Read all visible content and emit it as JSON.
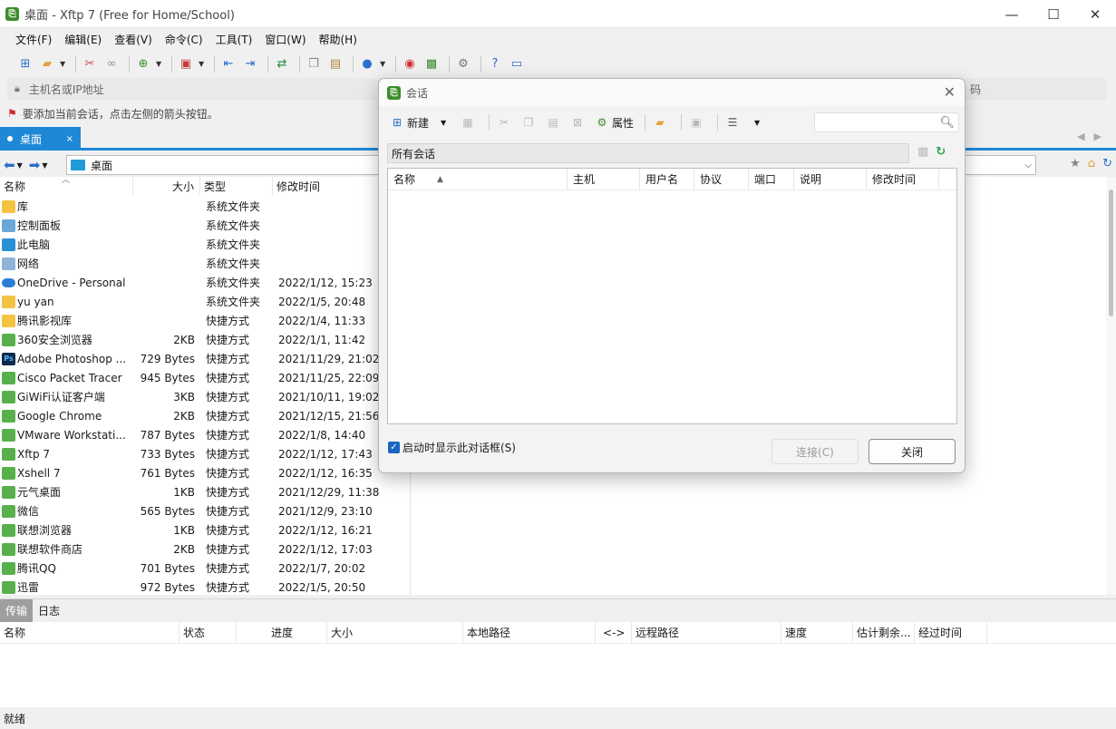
{
  "window": {
    "title": "桌面 - Xftp 7 (Free for Home/School)",
    "controls": [
      "—",
      "☐",
      "✕"
    ]
  },
  "menu": [
    "文件(F)",
    "编辑(E)",
    "查看(V)",
    "命令(C)",
    "工具(T)",
    "窗口(W)",
    "帮助(H)"
  ],
  "address": {
    "placeholder": "主机名或IP地址",
    "right_placeholder": "码"
  },
  "hint": "要添加当前会话，点击左侧的箭头按钮。",
  "tab": {
    "label": "桌面",
    "close": "×"
  },
  "path": {
    "current": "桌面"
  },
  "file_list": {
    "headers": [
      "名称",
      "大小",
      "类型",
      "修改时间"
    ],
    "rows": [
      {
        "icon": "folder-icon",
        "name": "库",
        "size": "",
        "type": "系统文件夹",
        "modified": ""
      },
      {
        "icon": "control-panel-icon",
        "name": "控制面板",
        "size": "",
        "type": "系统文件夹",
        "modified": ""
      },
      {
        "icon": "computer-icon",
        "name": "此电脑",
        "size": "",
        "type": "系统文件夹",
        "modified": ""
      },
      {
        "icon": "network-icon",
        "name": "网络",
        "size": "",
        "type": "系统文件夹",
        "modified": ""
      },
      {
        "icon": "cloud-icon",
        "name": "OneDrive - Personal",
        "size": "",
        "type": "系统文件夹",
        "modified": "2022/1/12, 15:23"
      },
      {
        "icon": "folder-icon",
        "name": "yu yan",
        "size": "",
        "type": "系统文件夹",
        "modified": "2022/1/5, 20:48"
      },
      {
        "icon": "folder-icon",
        "name": "腾讯影视库",
        "size": "",
        "type": "快捷方式",
        "modified": "2022/1/4, 11:33"
      },
      {
        "icon": "shortcut-icon",
        "name": "360安全浏览器",
        "size": "2KB",
        "type": "快捷方式",
        "modified": "2022/1/1, 11:42"
      },
      {
        "icon": "photoshop-icon",
        "name": "Adobe Photoshop ...",
        "size": "729 Bytes",
        "type": "快捷方式",
        "modified": "2021/11/29, 21:02"
      },
      {
        "icon": "shortcut-icon",
        "name": "Cisco Packet Tracer",
        "size": "945 Bytes",
        "type": "快捷方式",
        "modified": "2021/11/25, 22:09"
      },
      {
        "icon": "wifi-icon",
        "name": "GiWiFi认证客户端",
        "size": "3KB",
        "type": "快捷方式",
        "modified": "2021/10/11, 19:02"
      },
      {
        "icon": "chrome-icon",
        "name": "Google Chrome",
        "size": "2KB",
        "type": "快捷方式",
        "modified": "2021/12/15, 21:56"
      },
      {
        "icon": "vmware-icon",
        "name": "VMware Workstati...",
        "size": "787 Bytes",
        "type": "快捷方式",
        "modified": "2022/1/8, 14:40"
      },
      {
        "icon": "xftp-icon",
        "name": "Xftp 7",
        "size": "733 Bytes",
        "type": "快捷方式",
        "modified": "2022/1/12, 17:43"
      },
      {
        "icon": "xshell-icon",
        "name": "Xshell 7",
        "size": "761 Bytes",
        "type": "快捷方式",
        "modified": "2022/1/12, 16:35"
      },
      {
        "icon": "shortcut-icon",
        "name": "元气桌面",
        "size": "1KB",
        "type": "快捷方式",
        "modified": "2021/12/29, 11:38"
      },
      {
        "icon": "wechat-icon",
        "name": "微信",
        "size": "565 Bytes",
        "type": "快捷方式",
        "modified": "2021/12/9, 23:10"
      },
      {
        "icon": "shortcut-icon",
        "name": "联想浏览器",
        "size": "1KB",
        "type": "快捷方式",
        "modified": "2022/1/12, 16:21"
      },
      {
        "icon": "shortcut-icon",
        "name": "联想软件商店",
        "size": "2KB",
        "type": "快捷方式",
        "modified": "2022/1/12, 17:03"
      },
      {
        "icon": "qq-icon",
        "name": "腾讯QQ",
        "size": "701 Bytes",
        "type": "快捷方式",
        "modified": "2022/1/7, 20:02"
      },
      {
        "icon": "thunder-icon",
        "name": "迅雷",
        "size": "972 Bytes",
        "type": "快捷方式",
        "modified": "2022/1/5, 20:50"
      }
    ]
  },
  "bottom_tabs": [
    "传输",
    "日志"
  ],
  "transfer": {
    "headers": [
      "名称",
      "状态",
      "进度",
      "大小",
      "本地路径",
      "<->",
      "远程路径",
      "速度",
      "估计剩余...",
      "经过时间"
    ]
  },
  "status": "就绪",
  "dialog": {
    "title": "会话",
    "toolbar": {
      "new_label": "新建",
      "properties_label": "属性"
    },
    "path": "所有会话",
    "headers": [
      "名称",
      "主机",
      "用户名",
      "协议",
      "端口",
      "说明",
      "修改时间"
    ],
    "show_on_startup_label": "启动时显示此对话框(S)",
    "show_on_startup_checked": true,
    "connect_label": "连接(C)",
    "close_label": "关闭"
  },
  "colors": {
    "accent": "#1e88d6",
    "checkbox": "#1a66c4"
  }
}
